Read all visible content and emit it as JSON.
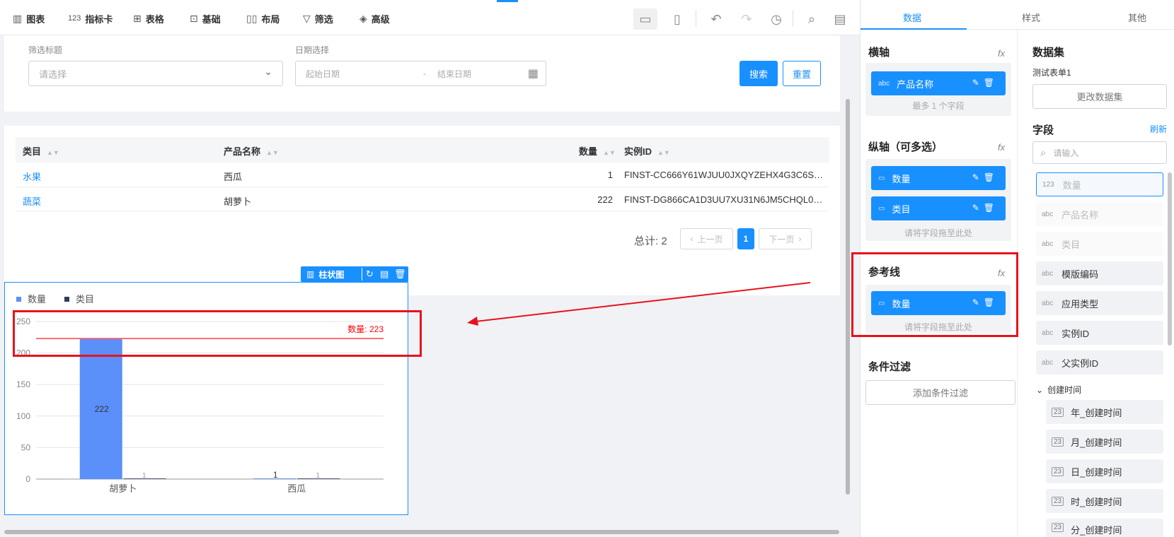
{
  "toolbar": {
    "items": [
      {
        "icon": "bar-chart-icon",
        "label": "图表"
      },
      {
        "icon": "number-card-icon",
        "label": "指标卡"
      },
      {
        "icon": "table-icon",
        "label": "表格"
      },
      {
        "icon": "basic-icon",
        "label": "基础"
      },
      {
        "icon": "layout-icon",
        "label": "布局"
      },
      {
        "icon": "filter-icon",
        "label": "筛选"
      },
      {
        "icon": "advanced-icon",
        "label": "高级"
      }
    ],
    "number_glyph": "123"
  },
  "filter": {
    "title_label": "筛选标题",
    "select_placeholder": "请选择",
    "date_label": "日期选择",
    "start_placeholder": "起始日期",
    "date_sep": "-",
    "end_placeholder": "结束日期",
    "search_label": "搜索",
    "reset_label": "重置"
  },
  "table": {
    "columns": [
      "类目",
      "产品名称",
      "数量",
      "实例ID"
    ],
    "rows": [
      {
        "category": "水果",
        "product": "西瓜",
        "qty": "1",
        "id": "FINST-CC666Y61WJUU0JXQYZEHX4G3C6S…"
      },
      {
        "category": "蔬菜",
        "product": "胡萝卜",
        "qty": "222",
        "id": "FINST-DG866CA1D3UU7XU31N6JM5CHQL0…"
      }
    ],
    "total": "总计: 2",
    "prev": "上一页",
    "page": "1",
    "next": "下一页"
  },
  "chart_widget": {
    "type_label": "柱状图"
  },
  "chart_data": {
    "type": "bar",
    "categories": [
      "胡萝卜",
      "西瓜"
    ],
    "series": [
      {
        "name": "数量",
        "values": [
          222,
          1
        ],
        "color": "#5b8ff9"
      },
      {
        "name": "类目",
        "values": [
          1,
          1
        ],
        "color": "#2f3a5c"
      }
    ],
    "data_labels": [
      "222",
      "1"
    ],
    "series2_labels": [
      "1",
      "1"
    ],
    "ylim": [
      0,
      250
    ],
    "yticks": [
      0,
      50,
      100,
      150,
      200,
      250
    ],
    "reference_line": {
      "value": 223,
      "label": "数量: 223",
      "color": "#ff0000"
    },
    "grid": true,
    "legend_position": "top-left"
  },
  "panel": {
    "tabs": [
      "数据",
      "样式",
      "其他"
    ],
    "x_axis": {
      "title": "横轴",
      "fx": "fx",
      "field_tag": "abc",
      "field": "产品名称",
      "hint": "最多 1 个字段"
    },
    "y_axis": {
      "title": "纵轴（可多选）",
      "fx": "fx",
      "fields": [
        {
          "tag": "▭",
          "name": "数量"
        },
        {
          "tag": "▭",
          "name": "类目"
        }
      ],
      "hint": "请将字段拖至此处"
    },
    "ref_line": {
      "title": "参考线",
      "fx": "fx",
      "field_tag": "▭",
      "field": "数量",
      "hint": "请将字段拖至此处"
    },
    "condition": {
      "title": "条件过滤",
      "add_label": "添加条件过滤"
    },
    "dataset": {
      "title": "数据集",
      "name": "测试表单1",
      "change_label": "更改数据集"
    },
    "fields": {
      "title": "字段",
      "refresh": "刷新",
      "search_placeholder": "请输入",
      "items": [
        {
          "tag": "123",
          "name": "数量",
          "disabled": true
        },
        {
          "tag": "abc",
          "name": "产品名称",
          "disabled": true
        },
        {
          "tag": "abc",
          "name": "类目",
          "disabled": true
        },
        {
          "tag": "abc",
          "name": "模版编码",
          "disabled": false
        },
        {
          "tag": "abc",
          "name": "应用类型",
          "disabled": false
        },
        {
          "tag": "abc",
          "name": "实例ID",
          "disabled": false
        },
        {
          "tag": "abc",
          "name": "父实例ID",
          "disabled": false
        }
      ],
      "group": "创建时间",
      "group_tag": "23",
      "date_items": [
        "年_创建时间",
        "月_创建时间",
        "日_创建时间",
        "时_创建时间",
        "分_创建时间"
      ]
    }
  }
}
